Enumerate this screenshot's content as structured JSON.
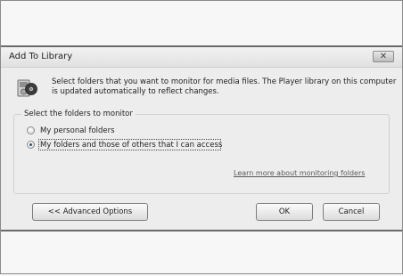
{
  "dialog": {
    "title": "Add To Library",
    "close_symbol": "✕",
    "description": "Select folders that you want to monitor for media files. The Player library on this computer is updated automatically to reflect changes.",
    "group_label": "Select the folders to monitor",
    "options": [
      {
        "label": "My personal folders",
        "selected": false
      },
      {
        "label": "My folders and those of others that I can access",
        "selected": true
      }
    ],
    "learn_more_link": "Learn more about monitoring folders",
    "buttons": {
      "advanced": "<< Advanced Options",
      "ok": "OK",
      "cancel": "Cancel"
    },
    "icons": {
      "library": "media-library-icon"
    }
  }
}
